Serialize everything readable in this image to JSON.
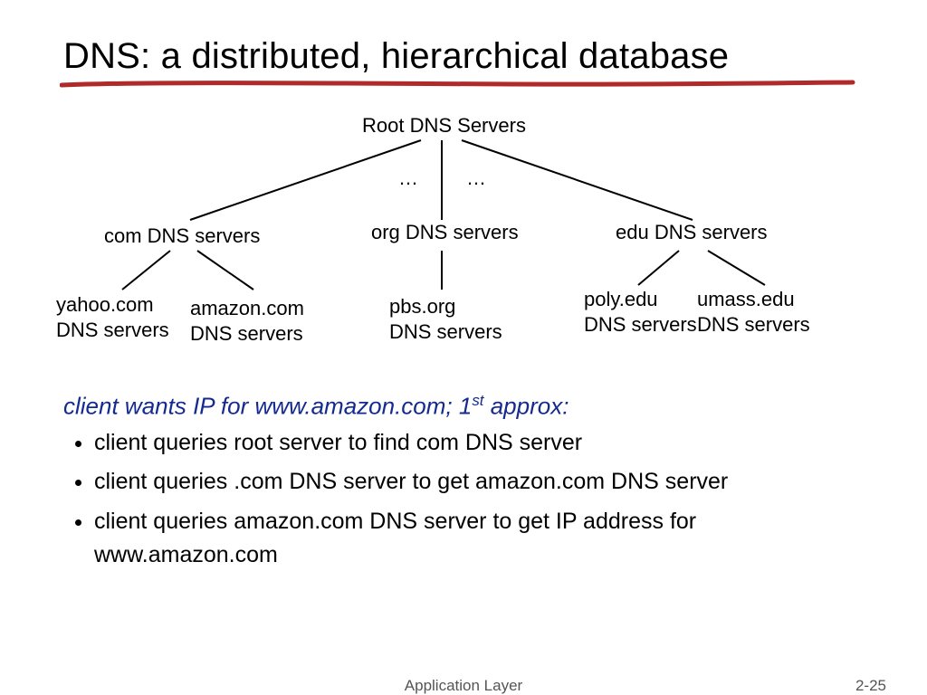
{
  "title": "DNS: a distributed, hierarchical database",
  "tree": {
    "root": "Root DNS Servers",
    "ellipsis_left": "…",
    "ellipsis_right": "…",
    "tld": {
      "com": "com DNS servers",
      "org": "org DNS servers",
      "edu": "edu DNS servers"
    },
    "leaf": {
      "yahoo_l1": "yahoo.com",
      "yahoo_l2": "DNS servers",
      "amazon_l1": "amazon.com",
      "amazon_l2": "DNS servers",
      "pbs_l1": "pbs.org",
      "pbs_l2": "DNS servers",
      "poly_l1": "poly.edu",
      "poly_l2": "DNS servers",
      "umass_l1": "umass.edu",
      "umass_l2": "DNS servers"
    }
  },
  "subhead_pre": "client wants IP for www.amazon.com; 1",
  "subhead_sup": "st",
  "subhead_post": " approx:",
  "bullets": [
    "client queries root server to find com DNS server",
    "client queries .com DNS server to get amazon.com DNS server",
    "client queries amazon.com DNS server to get  IP address for www.amazon.com"
  ],
  "footer_center": "Application Layer",
  "footer_right": "2-25"
}
